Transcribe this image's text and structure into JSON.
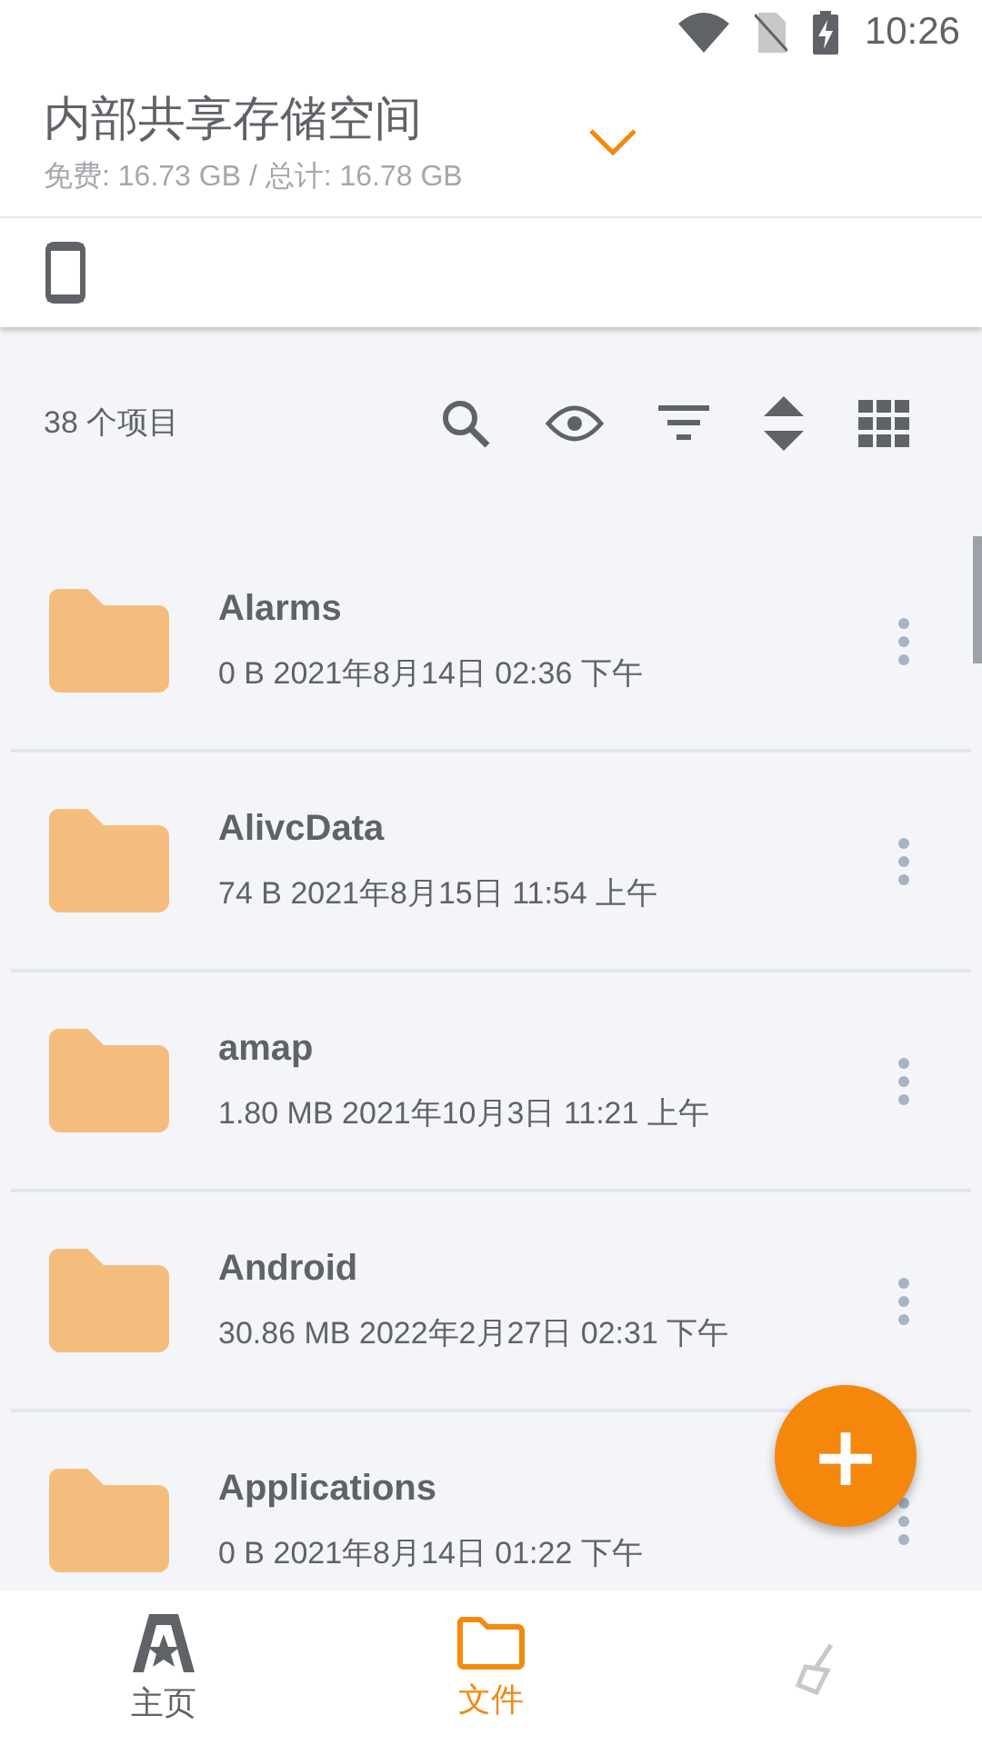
{
  "status_bar": {
    "time": "10:26"
  },
  "storage": {
    "title": "内部共享存储空间",
    "subtitle": "免费: 16.73 GB / 总计: 16.78 GB"
  },
  "toolbar": {
    "count": "38 个项目"
  },
  "files": [
    {
      "name": "Alarms",
      "details": "0 B 2021年8月14日 02:36 下午"
    },
    {
      "name": "AlivcData",
      "details": "74 B 2021年8月15日 11:54 上午"
    },
    {
      "name": "amap",
      "details": "1.80 MB 2021年10月3日 11:21 上午"
    },
    {
      "name": "Android",
      "details": "30.86 MB 2022年2月27日 02:31 下午"
    },
    {
      "name": "Applications",
      "details": "0 B 2021年8月14日 01:22 下午"
    }
  ],
  "fab": {
    "label": "+"
  },
  "nav": [
    {
      "kind": "home",
      "label": "主页",
      "selected": false
    },
    {
      "kind": "files",
      "label": "文件",
      "selected": true
    },
    {
      "kind": "tools",
      "selected": false
    }
  ]
}
